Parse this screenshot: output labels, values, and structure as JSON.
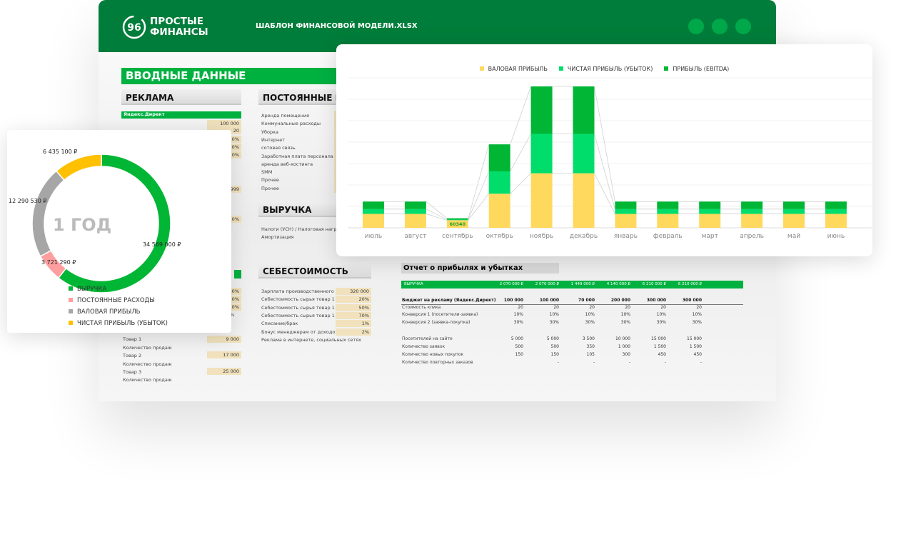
{
  "header": {
    "logo_line1": "ПРОСТЫЕ",
    "logo_line2": "ФИНАНСЫ",
    "logo_mark": "96",
    "file_title": "ШАБЛОН ФИНАНСОВОЙ МОДЕЛИ.XLSX"
  },
  "sheet": {
    "title": "ВВОДНЫЕ ДАННЫЕ",
    "advert": {
      "title": "РЕКЛАМА",
      "subheader": "Яндекс.Директ",
      "values": [
        "100 000",
        "20",
        "10%",
        "30%",
        "0%"
      ],
      "partial_value": "999",
      "partial_pct": "10%"
    },
    "left_pcts": [
      "60%",
      "20%",
      "20%",
      "00%"
    ],
    "products": [
      {
        "label": "Товар 1",
        "value": "9 000"
      },
      {
        "label": "Количество продаж"
      },
      {
        "label": "Товар 2",
        "value": "17 000"
      },
      {
        "label": "Количество продаж"
      },
      {
        "label": "Товар 3",
        "value": "25 000"
      },
      {
        "label": "Количество продаж"
      }
    ],
    "fixed": {
      "title": "ПОСТОЯННЫЕ РАСХОДЫ",
      "items": [
        "Аренда помещения",
        "Коммунальные расходы",
        "Уборка",
        "Интернет",
        "сотовая связь",
        "Заработная плата персонала АУП",
        "аренда веб-хостинга",
        "SMM",
        "Прочее",
        "Прочее"
      ]
    },
    "revenue": {
      "title": "ВЫРУЧКА",
      "items": [
        "Налоги (УСН) / Налоговая нагрузка",
        "Амортизация"
      ]
    },
    "cost": {
      "title": "СЕБЕСТОИМОСТЬ",
      "items": [
        {
          "label": "Зарплата производственного персонала",
          "value": "320 000"
        },
        {
          "label": "Себестоимость сырья товар 1",
          "value": "20%"
        },
        {
          "label": "Себестоимость сырья товар 1",
          "value": "50%"
        },
        {
          "label": "Себестоимость сырья товар 1",
          "value": "70%"
        },
        {
          "label": "Списание/брак",
          "value": "1%"
        },
        {
          "label": "Бонус менеджерам от доходов",
          "value": "2%"
        },
        {
          "label": "Реклама в интернете, социальных сетях"
        }
      ]
    }
  },
  "pnl": {
    "title": "Отчет о прибылях и убытках",
    "revenue_row": {
      "label": "ВЫРУЧКА",
      "values": [
        "2 070 000 ₽",
        "2 070 000 ₽",
        "1 449 000 ₽",
        "4 140 000 ₽",
        "6 210 000 ₽",
        "6 210 000 ₽"
      ]
    },
    "rows": [
      {
        "label": "Бюджет на рекламу (Яндекс.Директ)",
        "values": [
          "100 000",
          "100 000",
          "70 000",
          "200 000",
          "300 000",
          "300 000"
        ],
        "bold": true
      },
      {
        "label": "Стоимость клика",
        "values": [
          "20",
          "20",
          "20",
          "20",
          "20",
          "20"
        ]
      },
      {
        "label": "Конверсия 1 (посетители-заявка)",
        "values": [
          "10%",
          "10%",
          "10%",
          "10%",
          "10%",
          "10%"
        ]
      },
      {
        "label": "Конверсия 2 (заявка-покупка)",
        "values": [
          "30%",
          "30%",
          "30%",
          "30%",
          "30%",
          "30%"
        ]
      },
      {
        "label": "",
        "values": [
          "",
          "",
          "",
          "",
          "",
          ""
        ]
      },
      {
        "label": "Посетителей на сайте",
        "values": [
          "5 000",
          "5 000",
          "3 500",
          "10 000",
          "15 000",
          "15 000"
        ]
      },
      {
        "label": "Количество заявок",
        "values": [
          "500",
          "500",
          "350",
          "1 000",
          "1 500",
          "1 500"
        ]
      },
      {
        "label": "Количество новых покупок",
        "values": [
          "150",
          "150",
          "105",
          "300",
          "450",
          "450"
        ]
      },
      {
        "label": "Количество повторных заказов",
        "values": [
          "",
          "-",
          "-",
          "-",
          "-",
          "-"
        ]
      }
    ]
  },
  "chart_data": [
    {
      "type": "bar",
      "stacked": true,
      "grid": true,
      "legend": "top",
      "categories": [
        "июль",
        "август",
        "сентябрь",
        "октябрь",
        "ноябрь",
        "декабрь",
        "январь",
        "февраль",
        "март",
        "апрель",
        "май",
        "июнь"
      ],
      "series": [
        {
          "name": "ВАЛОВАЯ ПРИБЫЛЬ",
          "color": "#ffd95e",
          "values": [
            110000,
            110000,
            60340,
            270000,
            432000,
            432000,
            110000,
            110000,
            110000,
            110000,
            110000,
            110000
          ]
        },
        {
          "name": "ЧИСТАЯ ПРИБЫЛЬ (УБЫТОК)",
          "color": "#00dd6a",
          "values": [
            38000,
            38000,
            5000,
            177000,
            312000,
            312000,
            38000,
            38000,
            38000,
            38000,
            38000,
            38000
          ]
        },
        {
          "name": "ПРИБЫЛЬ (EBITDA)",
          "color": "#00b634",
          "values": [
            60000,
            60000,
            10000,
            214000,
            376000,
            376000,
            60000,
            60000,
            60000,
            60000,
            60000,
            60000
          ]
        }
      ],
      "data_labels": [
        {
          "category": "сентябрь",
          "text": "60340"
        }
      ]
    },
    {
      "type": "pie",
      "donut": true,
      "center_label": "1 ГОД",
      "legend": "bottom",
      "slices": [
        {
          "name": "ВЫРУЧКА",
          "value": 34569000,
          "label": "34 569 000 ₽",
          "color": "#00b634"
        },
        {
          "name": "ПОСТОЯННЫЕ РАСХОДЫ",
          "value": 3721290,
          "label": "3 721 290 ₽",
          "color": "#ff9e9e"
        },
        {
          "name": "ВАЛОВАЯ ПРИБЫЛЬ",
          "value": 12290530,
          "label": "12 290 530 ₽",
          "color": "#a6a6a6"
        },
        {
          "name": "ЧИСТАЯ ПРИБЫЛЬ (УБЫТОК)",
          "value": 6435100,
          "label": "6 435 100 ₽",
          "color": "#ffc000"
        }
      ]
    }
  ]
}
